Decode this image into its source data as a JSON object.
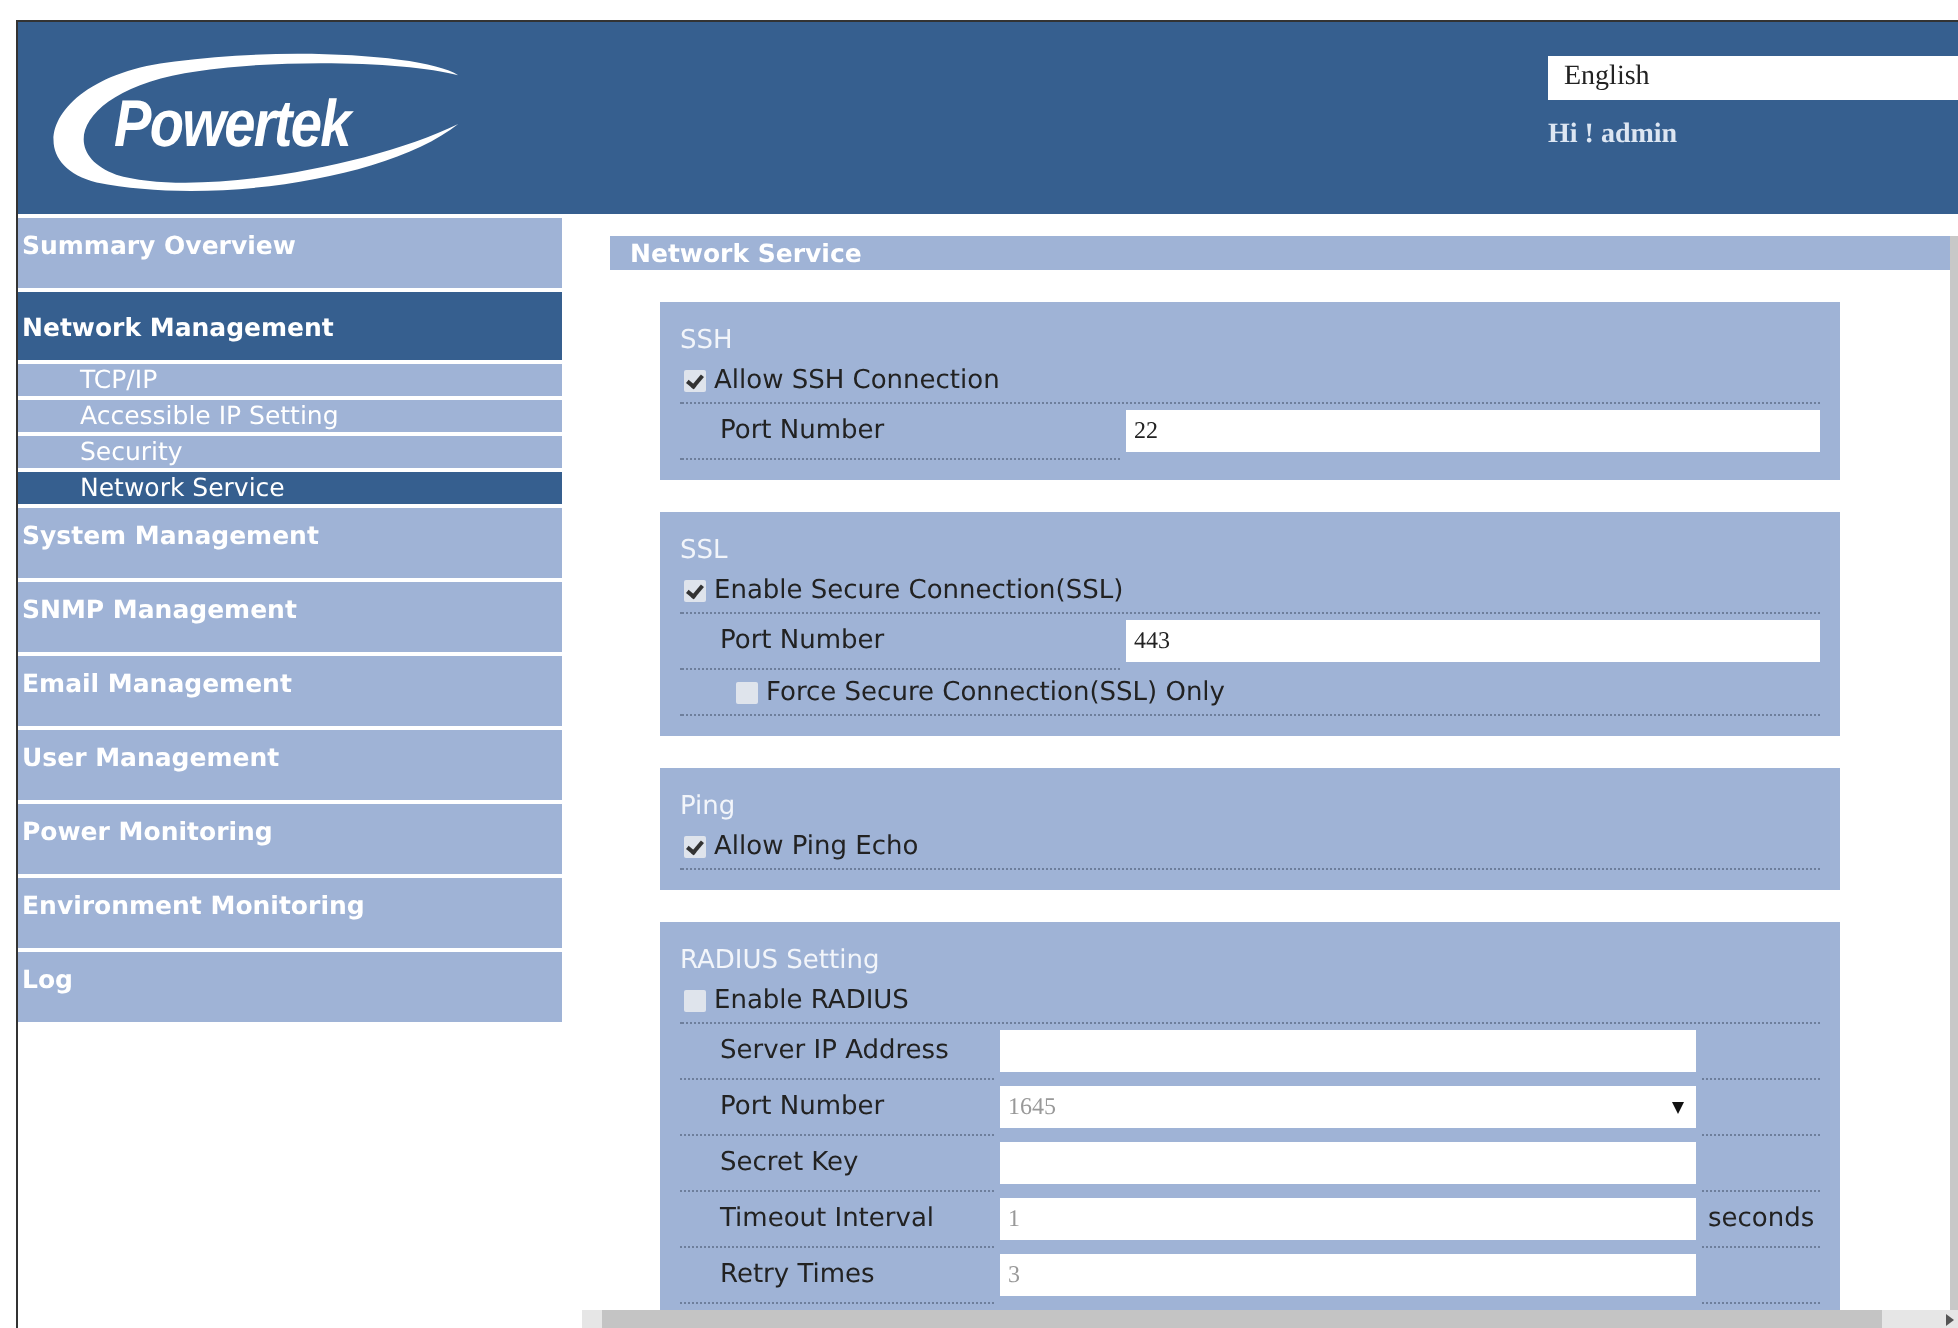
{
  "header": {
    "logo": "Powertek",
    "language": "English",
    "greeting": "Hi ! admin"
  },
  "sidebar": {
    "items": [
      {
        "label": "Summary Overview",
        "selected": false
      },
      {
        "label": "Network Management",
        "selected": true,
        "children": [
          {
            "label": "TCP/IP",
            "selected": false
          },
          {
            "label": "Accessible IP Setting",
            "selected": false
          },
          {
            "label": "Security",
            "selected": false
          },
          {
            "label": "Network Service",
            "selected": true
          }
        ]
      },
      {
        "label": "System Management",
        "selected": false
      },
      {
        "label": "SNMP Management",
        "selected": false
      },
      {
        "label": "Email Management",
        "selected": false
      },
      {
        "label": "User Management",
        "selected": false
      },
      {
        "label": "Power Monitoring",
        "selected": false
      },
      {
        "label": "Environment Monitoring",
        "selected": false
      },
      {
        "label": "Log",
        "selected": false
      }
    ]
  },
  "page_title": "Network Service",
  "sections": [
    {
      "title": "SSH",
      "rows": [
        {
          "kind": "checkbox",
          "label": "Allow SSH Connection",
          "checked": true
        },
        {
          "kind": "text",
          "label": "Port Number",
          "value": "22",
          "disabled": false
        }
      ]
    },
    {
      "title": "SSL",
      "rows": [
        {
          "kind": "checkbox",
          "label": "Enable Secure Connection(SSL)",
          "checked": true
        },
        {
          "kind": "text",
          "label": "Port Number",
          "value": "443",
          "disabled": false
        },
        {
          "kind": "subcheckbox",
          "label": "Force Secure Connection(SSL) Only",
          "checked": false
        }
      ]
    },
    {
      "title": "Ping",
      "rows": [
        {
          "kind": "checkbox",
          "label": "Allow Ping Echo",
          "checked": true
        }
      ]
    },
    {
      "title": "RADIUS Setting",
      "rows": [
        {
          "kind": "checkbox",
          "label": "Enable RADIUS",
          "checked": false
        },
        {
          "kind": "text",
          "label": "Server IP Address"
        },
        {
          "kind": "select",
          "label": "Port Number",
          "value": "1645",
          "disabled": true
        },
        {
          "kind": "text",
          "label": "Secret Key"
        },
        {
          "kind": "text",
          "label": "Timeout Interval",
          "value": "1",
          "suffix": "seconds",
          "disabled": true
        },
        {
          "kind": "text",
          "label": "Retry Times",
          "value": "3",
          "disabled": true
        }
      ]
    }
  ]
}
